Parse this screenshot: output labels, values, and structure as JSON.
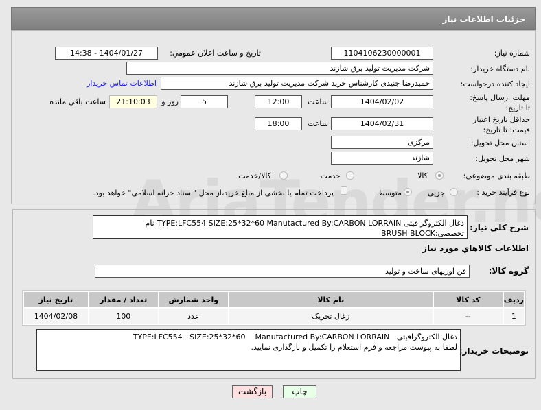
{
  "header": {
    "title": "جزئیات اطلاعات نیاز"
  },
  "form": {
    "need_number_label": "شماره نیاز:",
    "need_number": "1104106230000001",
    "announce_label": "تاریخ و ساعت اعلان عمومي:",
    "announce_value": "1404/01/27 - 14:38",
    "buyer_org_label": "نام دستگاه خریدار:",
    "buyer_org": "شرکت مدیریت تولید برق شازند",
    "creator_label": "ایجاد کننده درخواست:",
    "creator": "حمیدرضا جنیدی کارشناس خرید شرکت مدیریت تولید برق شازند",
    "contact_link": "اطلاعات تماس خریدار",
    "deadline_label": "مهلت ارسال پاسخ: تا تاریخ:",
    "deadline_date": "1404/02/02",
    "time_label": "ساعت",
    "deadline_time": "12:00",
    "days": "5",
    "days_label": "روز و",
    "remaining": "21:10:03",
    "remaining_label": "ساعت باقي مانده",
    "validity_label": "حداقل تاریخ اعتبار قیمت: تا تاریخ:",
    "validity_date": "1404/02/31",
    "validity_time": "18:00",
    "province_label": "استان محل تحویل:",
    "province": "مرکزی",
    "city_label": "شهر محل تحویل:",
    "city": "شازند",
    "category_label": "طبقه بندی موضوعی:",
    "category_options": [
      "کالا",
      "خدمت",
      "کالا/خدمت"
    ],
    "process_label": "نوع فرآیند خرید :",
    "process_options": [
      "جزیی",
      "متوسط"
    ],
    "payment_note": "پرداخت تمام یا بخشی از مبلغ خرید،از محل \"اسناد خزانه اسلامی\" خواهد بود."
  },
  "details": {
    "desc_label": "شرح کلي نیاز:",
    "desc": "ذغال الکتروگرافیتی   TYPE:LFC554   SIZE:25*32*60    Manutactured By:CARBON LORRAIN نام تخصصی:BRUSH BLOCK",
    "goods_heading": "اطلاعات کالاهاي مورد نیاز",
    "group_label": "گروه کالا:",
    "group": "فن آوریهای ساخت و تولید",
    "table": {
      "headers": [
        "ردیف",
        "کد کالا",
        "نام کالا",
        "واحد شمارش",
        "تعداد / مقدار",
        "تاریخ نیاز"
      ],
      "rows": [
        [
          "1",
          "--",
          "زغال تحریک",
          "عدد",
          "100",
          "1404/02/08"
        ]
      ]
    },
    "notes_label": "توضیحات خریدار:",
    "notes": "ذغال الکتروگرافیتی   TYPE:LFC554   SIZE:25*32*60    Manutactured By:CARBON LORRAIN\nلطفا به پیوست مراجعه و فرم استعلام را تکمیل و بارگذاری نمایید."
  },
  "buttons": {
    "print": "چاپ",
    "back": "بازگشت"
  },
  "watermark": "AriaTender.net"
}
